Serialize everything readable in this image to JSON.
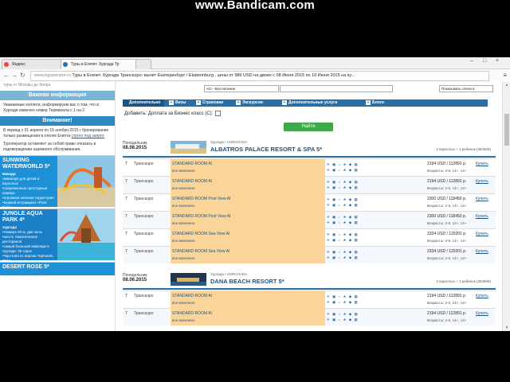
{
  "overlay": "www.Bandicam.com",
  "browser": {
    "tabs": [
      {
        "title": "Яндекс",
        "active": false
      },
      {
        "title": "Туры в Египет. Хургада Тр",
        "active": true
      },
      {
        "title": "",
        "active": false
      }
    ],
    "url_host": "www.bgoperator.ru",
    "url_rest": " Туры в Египет. Хургада Трансаэро: вылет Екатеринбург / Ekaterinburg , цены от 986 USD на двоих с 08 Июня 2015 по 10 Июня 2015 на ку..."
  },
  "sidebar": {
    "top_text": "туры от Москвы до Кипра",
    "important_header": "Важная информация",
    "important_text": "Уважаемые коллеги, информируем вас о том, что в Хургаде изменен номер Терминала с 1 на 2.",
    "attention_header": "Внимание!",
    "attention_text1": "В период с 01 апреля по 15 ноября 2015 г бронирование только размещения в отелях Египта ",
    "attention_link": "строго под запрос",
    "attention_text2": "Туроператор оставляет за собой право отказать в подтверждении наземного обслуживания.",
    "promos": [
      {
        "title": "SUNWING WATERWORLD 5*",
        "subtitle": "Макади",
        "lines": [
          "•аквапарк для детей и взрослых",
          "•современные просторные номера",
          "•огромная зеленая территория",
          "•водный аттракцион «Flow Rider»"
        ]
      },
      {
        "title": "JUNGLE AQUA PARK 4*",
        "subtitle": "Хургада",
        "lines": [
          "•Номера 40 м, две зоны",
          "•шесть тематических ресторанов",
          "•самый большой аквапарк в Хургаде: 35 горок",
          "•Top Hotel по версии Tophotels, 2014"
        ]
      },
      {
        "title": "DESERT ROSE 5*",
        "subtitle": "",
        "lines": []
      }
    ]
  },
  "filters": {
    "meal_select": "AO - Без питания",
    "sort_select": "Показывать отели в",
    "options": [
      "Дополнительно",
      "Визы",
      "Страховки",
      "Экскурсии",
      "Дополнительные услуги",
      "Блоги"
    ],
    "biz_label": "Добавить: Доплата за Бизнес класс (C):",
    "find_button": "Найти"
  },
  "results": [
    {
      "day": "Понедельник",
      "date": "08.06.2015",
      "region": "Хургада / HURGHADA",
      "hotel": "ALBATROS PALACE RESORT & SPA 5*",
      "pax": "2 взрослых + 1 ребенок (36/36/6)",
      "rows": [
        {
          "n": "7",
          "air": "Трансаэро",
          "room": "STANDARD ROOM AI",
          "meal": "все включено",
          "price": "2194 USD / 112891 р.",
          "ages": "Возрасты: 2-6, 14+, 14+",
          "buy": "Купить"
        },
        {
          "n": "7",
          "air": "Трансаэро",
          "room": "STANDARD ROOM AI",
          "meal": "все включено",
          "price": "2194 USD / 112891 р.",
          "ages": "Возрасты: 2-6, 14+, 14+",
          "buy": "Купить"
        },
        {
          "n": "7",
          "air": "Трансаэро",
          "room": "STANDARD ROOM Pool View AI",
          "meal": "все включено",
          "price": "2300 USD / 118450 р.",
          "ages": "Возрасты: 2-6, 14+, 14+",
          "buy": "Купить"
        },
        {
          "n": "7",
          "air": "Трансаэро",
          "room": "STANDARD ROOM Pool View AI",
          "meal": "все включено",
          "price": "2300 USD / 118450 р.",
          "ages": "Возрасты: 2-6, 14+, 14+",
          "buy": "Купить"
        },
        {
          "n": "7",
          "air": "Трансаэро",
          "room": "STANDARD ROOM Sea View AI",
          "meal": "все включено",
          "price": "2334 USD / 120201 р.",
          "ages": "Возрасты: 2-6, 14+, 14+",
          "buy": "Купить"
        },
        {
          "n": "7",
          "air": "Трансаэро",
          "room": "STANDARD ROOM Sea View AI",
          "meal": "все включено",
          "price": "2334 USD / 120201 р.",
          "ages": "Возрасты: 2-6, 14+, 14+",
          "buy": "Купить"
        }
      ]
    },
    {
      "day": "Понедельник",
      "date": "08.06.2015",
      "region": "Хургада / HURGHADA",
      "hotel": "DANA BEACH RESORT 5*",
      "pax": "2 взрослых + 1 ребенок (36/36/6)",
      "rows": [
        {
          "n": "7",
          "air": "Трансаэро",
          "room": "STANDARD ROOM AI",
          "meal": "все включено",
          "price": "2194 USD / 112891 р.",
          "ages": "Возрасты: 2-6, 14+, 14+",
          "buy": "Купить"
        },
        {
          "n": "7",
          "air": "Трансаэро",
          "room": "STANDARD ROOM AI",
          "meal": "все включено",
          "price": "2194 USD / 112891 р.",
          "ages": "Возрасты: 2-6, 14+, 14+",
          "buy": "Купить"
        }
      ]
    }
  ],
  "colors": {
    "accent": "#2a6ea6",
    "room_bg": "#fbd49a",
    "find_btn": "#3ea84a"
  }
}
